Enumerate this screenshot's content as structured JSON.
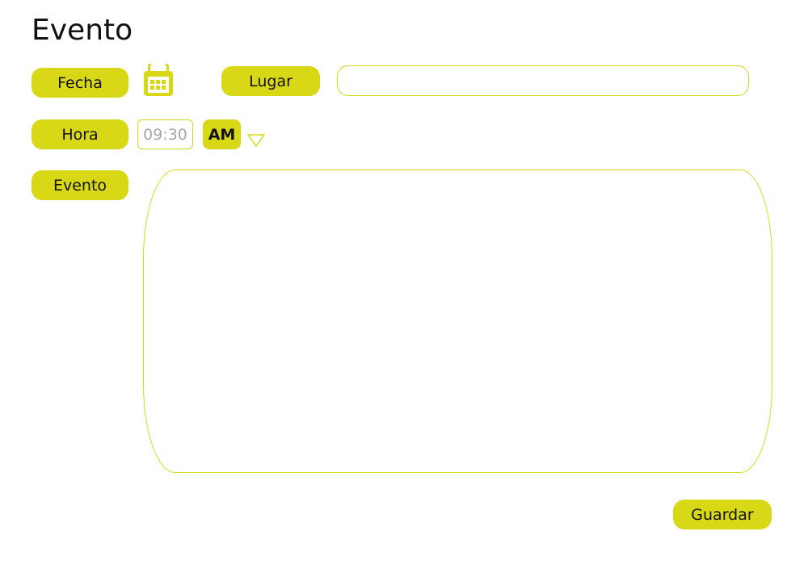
{
  "page": {
    "title": "Evento"
  },
  "form": {
    "date_label": "Fecha",
    "place_label": "Lugar",
    "place_value": "",
    "time_label": "Hora",
    "time_value": "09:30",
    "ampm_value": "AM",
    "event_label": "Evento",
    "event_value": ""
  },
  "actions": {
    "save_label": "Guardar"
  },
  "icons": {
    "calendar": "calendar-icon",
    "dropdown": "triangle-down-icon"
  },
  "colors": {
    "accent": "#d9d816",
    "text": "#111111",
    "time_text": "#a7a7a7"
  }
}
